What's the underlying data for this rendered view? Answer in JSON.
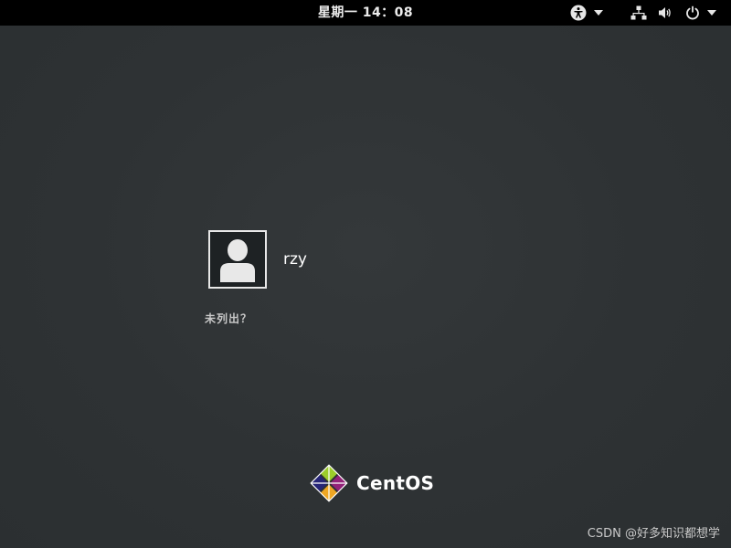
{
  "topbar": {
    "clock": "星期一 14：08",
    "icons": [
      "accessibility-icon",
      "network-icon",
      "volume-icon",
      "power-icon"
    ]
  },
  "login": {
    "users": [
      {
        "name": "rzy",
        "avatar_icon": "user-avatar-icon"
      }
    ],
    "not_listed_label": "未列出？"
  },
  "branding": {
    "logo_text": "CentOS",
    "logo_icon": "centos-logo-icon"
  },
  "watermark": "CSDN @好多知识都想学",
  "colors": {
    "background": "#2e3234",
    "topbar": "#000000",
    "text": "#ffffff"
  }
}
